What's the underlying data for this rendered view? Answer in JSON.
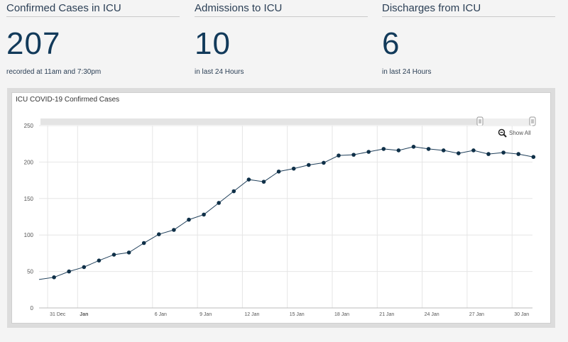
{
  "stats": [
    {
      "title": "Confirmed Cases in ICU",
      "value": "207",
      "sub": "recorded at 11am and 7:30pm"
    },
    {
      "title": "Admissions to ICU",
      "value": "10",
      "sub": "in last 24 Hours"
    },
    {
      "title": "Discharges from ICU",
      "value": "6",
      "sub": "in last 24 Hours"
    }
  ],
  "chart": {
    "show_all_label": "Show All",
    "zoom_icon": "zoom-out-icon"
  },
  "colors": {
    "line": "#1f3f5a",
    "marker": "#0f3048",
    "grid": "#e6e6e6"
  },
  "chart_data": {
    "type": "line",
    "title": "ICU COVID-19 Confirmed Cases",
    "xlabel": "",
    "ylabel": "",
    "ylim": [
      0,
      250
    ],
    "yticks": [
      0,
      50,
      100,
      150,
      200,
      250
    ],
    "xtick_labels": [
      "31 Dec",
      "Jan",
      "6 Jan",
      "9 Jan",
      "12 Jan",
      "15 Jan",
      "18 Jan",
      "21 Jan",
      "24 Jan",
      "27 Jan",
      "30 Jan"
    ],
    "grid": true,
    "legend": "none",
    "x": [
      "30 Dec",
      "31 Dec",
      "1 Jan",
      "2 Jan",
      "3 Jan",
      "4 Jan",
      "5 Jan",
      "6 Jan",
      "7 Jan",
      "8 Jan",
      "9 Jan",
      "10 Jan",
      "11 Jan",
      "12 Jan",
      "13 Jan",
      "14 Jan",
      "15 Jan",
      "16 Jan",
      "17 Jan",
      "18 Jan",
      "19 Jan",
      "20 Jan",
      "21 Jan",
      "22 Jan",
      "23 Jan",
      "24 Jan",
      "25 Jan",
      "26 Jan",
      "27 Jan",
      "28 Jan",
      "29 Jan",
      "30 Jan",
      "31 Jan",
      "1 Feb"
    ],
    "series": [
      {
        "values": [
          39,
          42,
          50,
          56,
          65,
          73,
          76,
          89,
          101,
          107,
          121,
          128,
          144,
          160,
          176,
          173,
          187,
          191,
          196,
          199,
          209,
          210,
          214,
          218,
          216,
          221,
          218,
          216,
          212,
          216,
          211,
          213,
          211,
          207
        ]
      }
    ]
  }
}
